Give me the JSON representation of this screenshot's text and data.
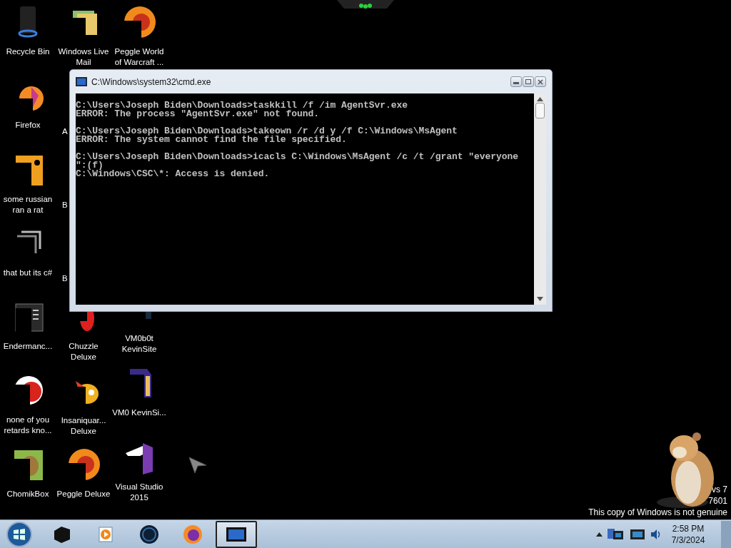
{
  "desktop": {
    "column_1": [
      {
        "label": "Recycle Bin",
        "kind": "bin"
      },
      {
        "label": "Firefox",
        "kind": "firefox"
      },
      {
        "label": "some russian ran a rat",
        "kind": "java"
      },
      {
        "label": "that but its c#",
        "kind": "frame"
      },
      {
        "label": "Endermanc...",
        "kind": "terminal"
      },
      {
        "label": "none of you retards kno...",
        "kind": "swirl"
      },
      {
        "label": "ChomikBox",
        "kind": "chomik"
      }
    ],
    "column_2": [
      {
        "label": "Windows Live Mail",
        "kind": "folder"
      },
      {
        "label": "A",
        "kind": "covered"
      },
      {
        "label": "B",
        "kind": "covered"
      },
      {
        "label": "B",
        "kind": "covered"
      },
      {
        "label": "Chuzzle Deluxe",
        "kind": "chuzzle"
      },
      {
        "label": "Insaniquar... Deluxe",
        "kind": "fish"
      },
      {
        "label": "Peggle Deluxe",
        "kind": "peggle"
      }
    ],
    "column_3_top": [
      {
        "label": "Peggle World of Warcraft ...",
        "kind": "peggle"
      }
    ],
    "column_3_bottom": [
      {
        "label": "VM0b0t KevinSite",
        "kind": "vm"
      },
      {
        "label": "VM0 KevinSi...",
        "kind": "purple"
      },
      {
        "label": "Visual Studio 2015",
        "kind": "vs"
      }
    ]
  },
  "window": {
    "title": "C:\\Windows\\system32\\cmd.exe",
    "console": [
      [
        "C:\\Users\\Joseph Biden\\Downloads>taskkill /f /im AgentSvr.exe",
        "ERROR: The process \"AgentSvr.exe\" not found."
      ],
      [
        "C:\\Users\\Joseph Biden\\Downloads>takeown /r /d y /f C:\\Windows\\MsAgent",
        "ERROR: The system cannot find the file specified."
      ],
      [
        "C:\\Users\\Joseph Biden\\Downloads>icacls C:\\Windows\\MsAgent /c /t /grant \"everyone",
        "\":(f)",
        "C:\\Windows\\CSC\\*: Access is denied."
      ]
    ]
  },
  "watermark": [
    "vs 7",
    "7601",
    "This copy of Windows is not genuine"
  ],
  "taskbar": {
    "items": [
      {
        "kind": "box",
        "selected": false
      },
      {
        "kind": "media",
        "selected": false
      },
      {
        "kind": "globe",
        "selected": false
      },
      {
        "kind": "firefox",
        "selected": false
      },
      {
        "kind": "console",
        "selected": true
      }
    ],
    "clock": {
      "time": "2:58 PM",
      "date": "7/3/2024"
    }
  }
}
